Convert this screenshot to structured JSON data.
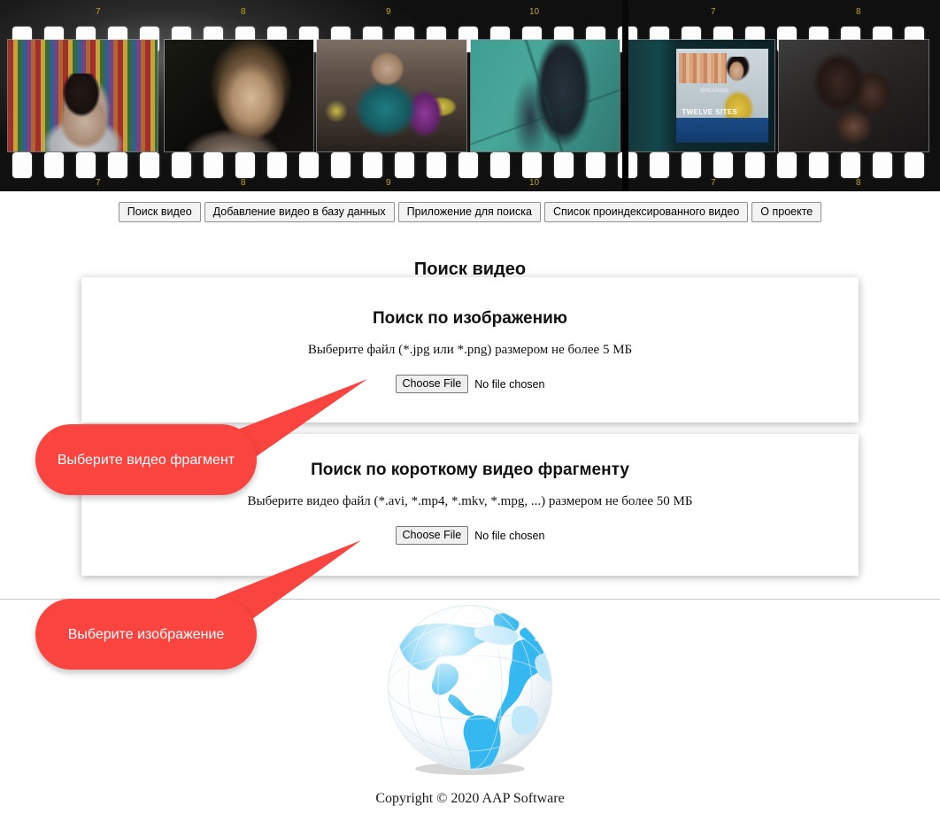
{
  "banner": {
    "type": "film-strip",
    "frame_numbers_top": [
      "7",
      "8",
      "9",
      "10",
      "7",
      "8"
    ],
    "frame_numbers_bottom": [
      "7",
      "8",
      "9",
      "10",
      "7",
      "8"
    ],
    "frames": [
      {
        "caption": "woman in pharmacy talking on phone"
      },
      {
        "caption": "older woman portrait on dark background"
      },
      {
        "caption": "person with hat and glasses on phone in market"
      },
      {
        "caption": "legs walking on teal pavement"
      },
      {
        "caption": "news broadcast on television screen",
        "ticker": "TWELVE SITES",
        "break_label": "BREAKING"
      },
      {
        "caption": "two people embracing in dark room"
      }
    ]
  },
  "nav": {
    "items": [
      {
        "label": "Поиск видео"
      },
      {
        "label": "Добавление видео в базу данных"
      },
      {
        "label": "Приложение для поиска"
      },
      {
        "label": "Список проиндексированного видео"
      },
      {
        "label": "О проекте"
      }
    ]
  },
  "page": {
    "title": "Поиск видео"
  },
  "panels": [
    {
      "id": "image",
      "title": "Поиск по изображению",
      "description": "Выберите файл (*.jpg или *.png) размером не более 5 МБ",
      "choose_label": "Choose File",
      "file_status": "No file chosen"
    },
    {
      "id": "video",
      "title": "Поиск по короткому видео фрагменту",
      "description": "Выберите видео файл (*.avi, *.mp4, *.mkv, *.mpg, ...) размером не более 50 МБ",
      "choose_label": "Choose File",
      "file_status": "No file chosen"
    }
  ],
  "callouts": [
    {
      "id": "video",
      "text": "Выберите видео фрагмент"
    },
    {
      "id": "image",
      "text": "Выберите изображение"
    }
  ],
  "footer": {
    "copyright": "Copyright © 2020 AAP Software",
    "logo": "globe-icon"
  },
  "colors": {
    "callout_red": "#f94440",
    "globe_blue": "#35b8ef",
    "globe_blue_light": "#bfe8fb",
    "film_number": "#c9a227",
    "divider": "#c8c8c8"
  }
}
